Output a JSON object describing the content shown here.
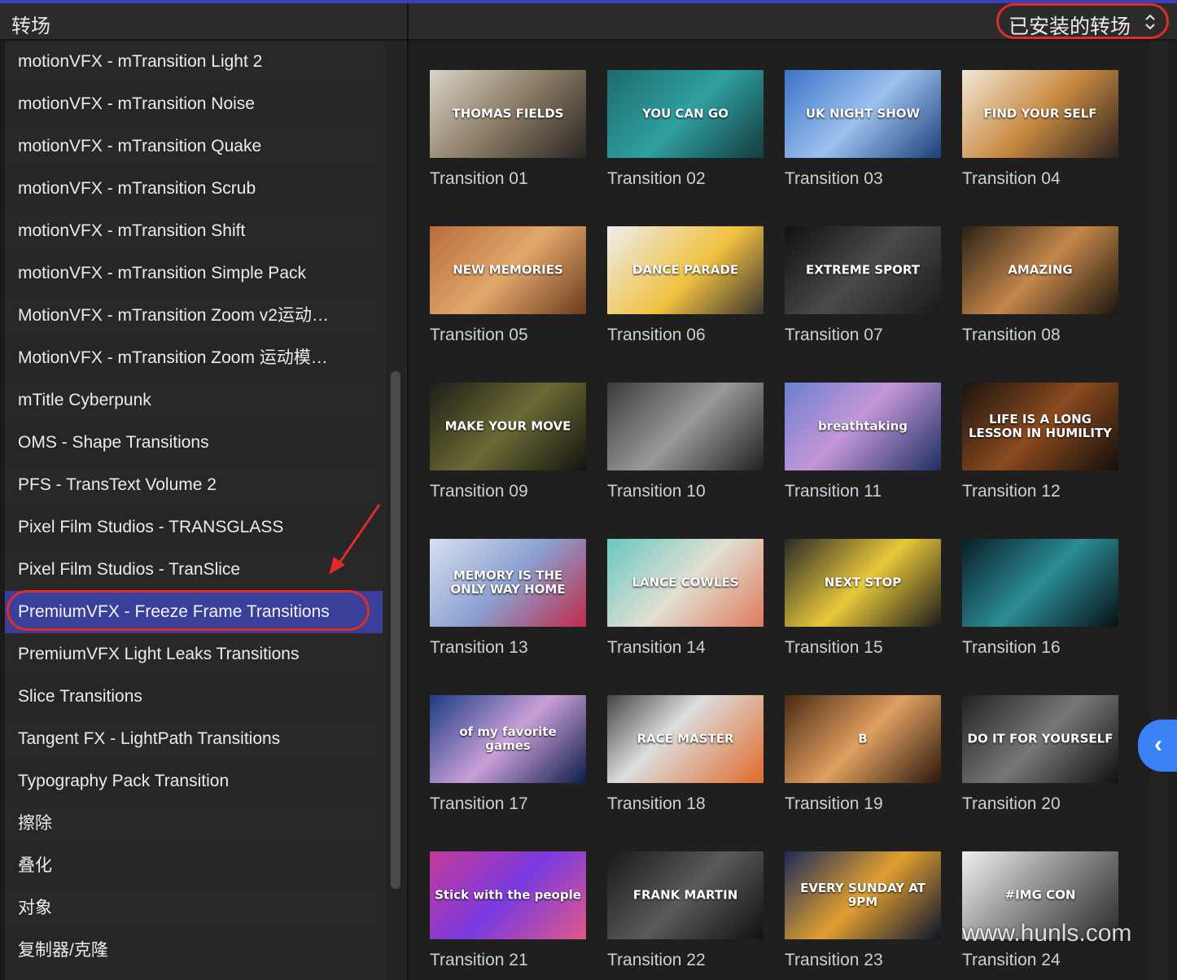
{
  "left_panel": {
    "title": "转场",
    "items": [
      "motionVFX - mTransition Light 2",
      "motionVFX - mTransition Noise",
      "motionVFX - mTransition Quake",
      "motionVFX - mTransition Scrub",
      "motionVFX - mTransition Shift",
      "motionVFX - mTransition Simple Pack",
      "MotionVFX - mTransition Zoom v2运动…",
      "MotionVFX - mTransition Zoom 运动模…",
      "mTitle Cyberpunk",
      "OMS - Shape Transitions",
      "PFS - TransText Volume 2",
      "Pixel Film Studios - TRANSGLASS",
      "Pixel Film Studios - TranSlice",
      "PremiumVFX - Freeze Frame Transitions",
      "PremiumVFX Light Leaks Transitions",
      "Slice Transitions",
      "Tangent FX - LightPath Transitions",
      "Typography Pack Transition",
      "擦除",
      "叠化",
      "对象",
      "复制器/克隆"
    ],
    "selected_index": 13
  },
  "right_panel": {
    "filter_label": "已安装的转场",
    "filter_icon": "up-down-chevron-icon",
    "collapse_icon": "chevron-left-icon"
  },
  "transitions": [
    {
      "label": "Transition 01",
      "thumb_text": "THOMAS FIELDS",
      "bg": "linear-gradient(135deg,#d9d4c7,#8a7b64 50%,#2a2622)"
    },
    {
      "label": "Transition 02",
      "thumb_text": "YOU CAN GO",
      "bg": "linear-gradient(135deg,#1d6b6c,#2fa0a0 50%,#153c3f)"
    },
    {
      "label": "Transition 03",
      "thumb_text": "UK NIGHT SHOW",
      "bg": "linear-gradient(135deg,#3c74c9,#9cc0ee 50%,#1d3f7a)"
    },
    {
      "label": "Transition 04",
      "thumb_text": "FIND YOUR SELF",
      "bg": "linear-gradient(135deg,#f0e8d8,#c98a42 50%,#2b2320)"
    },
    {
      "label": "Transition 05",
      "thumb_text": "NEW MEMORIES",
      "bg": "linear-gradient(135deg,#b86c3e,#e1a86a 50%,#6d3b1f)"
    },
    {
      "label": "Transition 06",
      "thumb_text": "DANCE PARADE",
      "bg": "linear-gradient(135deg,#eeeeee,#f0c040 55%,#3a3530)"
    },
    {
      "label": "Transition 07",
      "thumb_text": "EXTREME SPORT",
      "bg": "linear-gradient(135deg,#111111,#4a4a4a 50%,#1a1a1a)"
    },
    {
      "label": "Transition 08",
      "thumb_text": "AMAZING",
      "bg": "linear-gradient(135deg,#2b2118,#c4874a 50%,#1c150f)"
    },
    {
      "label": "Transition 09",
      "thumb_text": "MAKE YOUR MOVE",
      "bg": "linear-gradient(135deg,#1e1e18,#6b6a34 50%,#141410)"
    },
    {
      "label": "Transition 10",
      "thumb_text": "",
      "bg": "linear-gradient(135deg,#3a3a3a,#9a9a9a 50%,#222)"
    },
    {
      "label": "Transition 11",
      "thumb_text": "breathtaking",
      "bg": "linear-gradient(135deg,#6b7fd1,#c497d8 45%,#1e2f63)"
    },
    {
      "label": "Transition 12",
      "thumb_text": "LIFE IS A LONG LESSON IN HUMILITY",
      "bg": "linear-gradient(135deg,#1a1410,#8a4a1e 50%,#140f0c)"
    },
    {
      "label": "Transition 13",
      "thumb_text": "MEMORY IS THE ONLY WAY HOME",
      "bg": "linear-gradient(135deg,#d8dff0,#8aa0d0 50%,#c12a4a)"
    },
    {
      "label": "Transition 14",
      "thumb_text": "LANCE COWLES",
      "bg": "linear-gradient(135deg,#68c7c2,#e0e0d0 50%,#e07a5f)"
    },
    {
      "label": "Transition 15",
      "thumb_text": "NEXT STOP",
      "bg": "linear-gradient(135deg,#2a2a2a,#e8c83a 50%,#1c1c1c)"
    },
    {
      "label": "Transition 16",
      "thumb_text": "",
      "bg": "linear-gradient(135deg,#0b1e26,#2a8c95 50%,#081216)"
    },
    {
      "label": "Transition 17",
      "thumb_text": "of my favorite games",
      "bg": "linear-gradient(135deg,#1b3c86,#c9a0d8 50%,#0d1d48)"
    },
    {
      "label": "Transition 18",
      "thumb_text": "RACE MASTER",
      "bg": "linear-gradient(135deg,#444,#ddd 40%,#e06a2a)"
    },
    {
      "label": "Transition 19",
      "thumb_text": "B",
      "bg": "linear-gradient(135deg,#4a2a14,#e0a060 50%,#2a180c)"
    },
    {
      "label": "Transition 20",
      "thumb_text": "DO IT FOR YOURSELF",
      "bg": "linear-gradient(135deg,#222,#777 50%,#111)"
    },
    {
      "label": "Transition 21",
      "thumb_text": "Stick with the people",
      "bg": "linear-gradient(135deg,#c43a9a,#7a3ae0 50%,#e05a8a)"
    },
    {
      "label": "Transition 22",
      "thumb_text": "FRANK MARTIN",
      "bg": "linear-gradient(135deg,#1a1a1a,#5a5a5a 50%,#111)"
    },
    {
      "label": "Transition 23",
      "thumb_text": "EVERY SUNDAY AT 9PM",
      "bg": "linear-gradient(135deg,#1c2a5a,#e0a030 50%,#0c1430)"
    },
    {
      "label": "Transition 24",
      "thumb_text": "#IMG CON",
      "bg": "linear-gradient(135deg,#f0f0f0,#888 50%,#2a2a2a)"
    }
  ],
  "watermark": "www.hunls.com"
}
